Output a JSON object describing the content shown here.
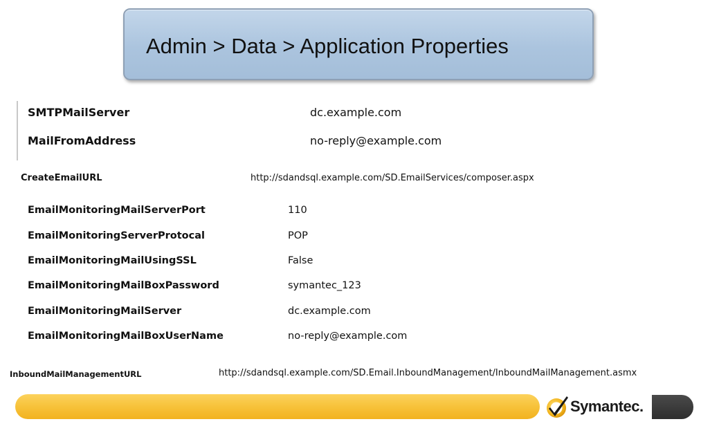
{
  "header": {
    "title": "Admin > Data > Application Properties"
  },
  "properties": {
    "smtp_mail_server": {
      "label": "SMTPMailServer",
      "value": "dc.example.com"
    },
    "mail_from_address": {
      "label": "MailFromAddress",
      "value": "no-reply@example.com"
    },
    "create_email_url": {
      "label": "CreateEmailURL",
      "value": "http://sdandsql.example.com/SD.EmailServices/composer.aspx"
    },
    "email_monitoring": [
      {
        "label": "EmailMonitoringMailServerPort",
        "value": "110"
      },
      {
        "label": "EmailMonitoringServerProtocal",
        "value": "POP"
      },
      {
        "label": "EmailMonitoringMailUsingSSL",
        "value": "False"
      },
      {
        "label": "EmailMonitoringMailBoxPassword",
        "value": "symantec_123"
      },
      {
        "label": "EmailMonitoringMailServer",
        "value": "dc.example.com"
      },
      {
        "label": "EmailMonitoringMailBoxUserName",
        "value": "no-reply@example.com"
      }
    ],
    "inbound_mail_management_url": {
      "label": "InboundMailManagementURL",
      "value": "http://sdandsql.example.com/SD.Email.InboundManagement/InboundMailManagement.asmx"
    }
  },
  "footer": {
    "logo_text": "Symantec.",
    "logo_icon": "checkmark-icon",
    "colors": {
      "bar": "#f7c23a",
      "dark_block": "#3a3a3a",
      "title_box": "#abc4de"
    }
  }
}
